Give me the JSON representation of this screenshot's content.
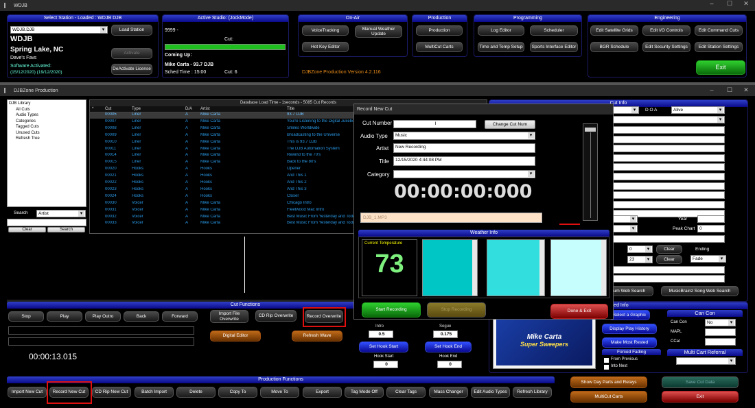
{
  "top_window": {
    "title": "WDJB",
    "controls": [
      "–",
      "☐",
      "✕"
    ]
  },
  "station": {
    "header": "Select Station - Loaded : WDJB DJB",
    "select": "WDJB.DJB",
    "load_btn": "Load Station",
    "callsign": "WDJB",
    "city": "Spring Lake, NC",
    "slogan": "Dave's Favs",
    "software": "Software Activated: ",
    "dates": "(15/12/2020) (19/12/2020)",
    "activate_btn": "Activate",
    "deactivate_btn": "DeActivate License"
  },
  "studio": {
    "header": "Active Studio: (JockMode)",
    "number": "9999 -",
    "cut_label": "Cut:",
    "coming_up": "Coming Up:",
    "jock": "Mike Carta - 93.7 DJB",
    "sched": "Sched Time : 15:00",
    "cut_count": "Cut: 6",
    "progress": 1.0
  },
  "onair": {
    "header": "On-Air",
    "buttons": [
      "VoiceTracking",
      "Manual Weather Update",
      "Hot Key Editor"
    ]
  },
  "production": {
    "header": "Production",
    "buttons": [
      "Production",
      "MultiCut Carts"
    ]
  },
  "programming": {
    "header": "Programming",
    "buttons": [
      "Log Editor",
      "Scheduler",
      "Time and Temp Setup",
      "Sports Interface Editor"
    ]
  },
  "engineering": {
    "header": "Engineering",
    "buttons": [
      "Edit Satellite Grids",
      "Edit I/O Controls",
      "Edit Command Cuts",
      "BGR Schedule",
      "Edit Security Settings",
      "Edit Station Settings"
    ],
    "exit": "Exit"
  },
  "version": "DJBZone Production Version 4.2.116",
  "prod_window": {
    "title": "DJBZone Production"
  },
  "library": {
    "items": [
      "DJB Library",
      "All Cuts",
      "Audio Types",
      "Categories",
      "Tagged Cuts",
      "Unused Cuts",
      "Refresh Tree"
    ],
    "search_label": "Search",
    "search_field": "Artist",
    "clear": "Clear",
    "search": "Search"
  },
  "grid": {
    "caption": "Database Load Time - 1seconds - 5085 Cut Records",
    "headers": [
      "*",
      "Cut",
      "Type",
      "D/A",
      "Artist",
      "Title"
    ],
    "rows": [
      [
        "00005",
        "Liner",
        "A",
        "Mike Carta",
        "93.7 DJB"
      ],
      [
        "00007",
        "Liner",
        "A",
        "Mike Carta",
        "You're Listening to the Digital Jukebox"
      ],
      [
        "00008",
        "Liner",
        "A",
        "Mike Carta",
        "Smiles Worldwide"
      ],
      [
        "00009",
        "Liner",
        "A",
        "Mike Carta",
        "Broadcasting to the Universe"
      ],
      [
        "00010",
        "Liner",
        "A",
        "Mike Carta",
        "This is 93.7 DJB"
      ],
      [
        "00011",
        "Liner",
        "A",
        "Mike Carta",
        "The DJB Automation System"
      ],
      [
        "00014",
        "Liner",
        "A",
        "Mike Carta",
        "Rewind to the 70's"
      ],
      [
        "00015",
        "Liner",
        "A",
        "Mike Carta",
        "Back to the 80's"
      ],
      [
        "00020",
        "Hooks",
        "A",
        "Hooks",
        "Opener"
      ],
      [
        "00021",
        "Hooks",
        "A",
        "Hooks",
        "And This 1"
      ],
      [
        "00022",
        "Hooks",
        "A",
        "Hooks",
        "And This 2"
      ],
      [
        "00023",
        "Hooks",
        "A",
        "Hooks",
        "And This 3"
      ],
      [
        "00024",
        "Hooks",
        "A",
        "Hooks",
        "Closer"
      ],
      [
        "00030",
        "Voicer",
        "A",
        "Mike Carta",
        "Chicago Intro"
      ],
      [
        "00031",
        "Voicer",
        "A",
        "Mike Carta",
        "Fleetwood Mac Intro"
      ],
      [
        "00032",
        "Voicer",
        "A",
        "Mike Carta",
        "Best Music From Yesterday and Today"
      ],
      [
        "00033",
        "Voicer",
        "A",
        "Mike Carta",
        "Best Music From Yesterday and Today"
      ]
    ]
  },
  "cut_functions": {
    "header": "Cut Functions",
    "transport": [
      "Stop",
      "Play",
      "Play Outro",
      "Back",
      "Forward"
    ],
    "import_overwrite": "Import File Overwrite",
    "cd_rip_overwrite": "CD Rip Overwrite",
    "record_overwrite": "Record Overwrite",
    "digital_editor": "Digital Editor",
    "refresh_wave": "Refresh Wave",
    "timer": "00:00:13.015"
  },
  "hooks": {
    "intro_label": "Intro",
    "intro_val": "0.5",
    "segue_label": "Segue",
    "segue_val": "0.175",
    "set_start": "Set Hook Start",
    "set_end": "Set Hook End",
    "start_label": "Hook Start",
    "start_val": "0",
    "end_label": "Hook End",
    "end_val": "0"
  },
  "production_functions": {
    "header": "Production Functions",
    "buttons": [
      "Import New Cut",
      "Record New Cut",
      "CD Rip New Cut",
      "Batch Import",
      "Delete",
      "Copy To",
      "Move To",
      "Export",
      "Tag Mode Off",
      "Clear Tags",
      "Mass Changer",
      "Edit Audio Types",
      "Refresh Library"
    ]
  },
  "cut_info": {
    "header": "Cut Info",
    "doa": "D O A",
    "alive": "Alive",
    "year": "Year",
    "peak": "Peak Chart",
    "peak_val": "0",
    "clear": "Clear",
    "ending": "Ending",
    "fade": "Fade",
    "f1": "0",
    "f2": "23",
    "web_search": "um Web Search",
    "brainz": "MusicBrainz Song Web Search"
  },
  "extended": {
    "header": "nded Info",
    "select_graphic": "Select a Graphic",
    "play_history": "Display Play History",
    "most_rested": "Make Most Rested",
    "forced_fading": "Forced Fading",
    "from_prev": "From Previous",
    "into_next": "Into Next",
    "cancon": "Can Con",
    "cancon_lbl": "Can Con",
    "cancon_val": "No",
    "mapl": "MAPL",
    "ccat": "CCat",
    "multicart": "Multi Cart Referral",
    "graphic_line1": "Mike Carta",
    "graphic_line2": "Super Sweepers"
  },
  "right_buttons": {
    "show_day": "Show Day Parts and Relays",
    "save": "Save Cut Data",
    "multicut": "MultiCut Carts",
    "exit": "Exit"
  },
  "dialog": {
    "title": "Record New Cut",
    "cut_number": "Cut Number",
    "cut_number_val": "I",
    "change": "Change Cut Num",
    "audio_type": "Audio Type",
    "audio_type_val": "Music",
    "artist": "Artist",
    "artist_val": "New Recording",
    "title_lbl": "Title",
    "title_val": "12/15/2020 4:44:08 PM",
    "category": "Category",
    "timer": "00:00:00:000",
    "filename": "DJB_1.MP3",
    "weather_header": "Weather Info",
    "current_temp": "Current Temperature",
    "temp": "73",
    "start": "Start Recording",
    "stop": "Stop Recording",
    "done": "Done & Exit"
  }
}
